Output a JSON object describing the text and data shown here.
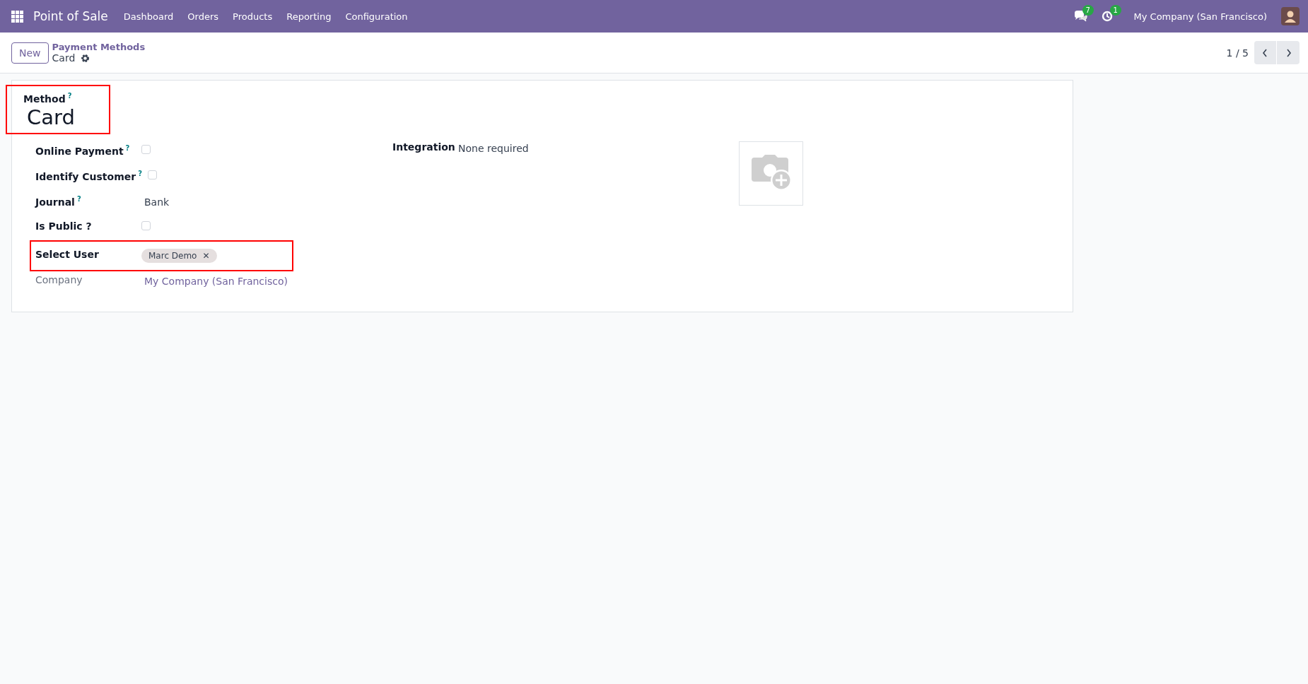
{
  "navbar": {
    "app_name": "Point of Sale",
    "menu": [
      "Dashboard",
      "Orders",
      "Products",
      "Reporting",
      "Configuration"
    ],
    "messages_count": "7",
    "activities_count": "1",
    "company": "My Company (San Francisco)"
  },
  "control_panel": {
    "new_button": "New",
    "breadcrumb": "Payment Methods",
    "record": "Card",
    "pager": "1 / 5"
  },
  "form": {
    "method": {
      "label": "Method",
      "help_mark": "?",
      "value": "Card",
      "highlighted": true
    },
    "fields": [
      {
        "kind": "checkbox",
        "label": "Online Payment",
        "help_mark": "?",
        "checked": false,
        "highlighted": false
      },
      {
        "kind": "checkbox",
        "label": "Identify Customer",
        "help_mark": "?",
        "checked": false,
        "highlighted": false
      },
      {
        "kind": "text",
        "label": "Journal",
        "help_mark": "?",
        "value": "Bank",
        "highlighted": false
      },
      {
        "kind": "checkbox",
        "label": "Is Public ?",
        "checked": false,
        "highlighted": false
      },
      {
        "kind": "tags",
        "label": "Select User",
        "tags": [
          {
            "label": "Marc Demo",
            "remove_mark": "✕"
          }
        ],
        "highlighted": true
      },
      {
        "kind": "link",
        "label": "Company",
        "value": "My Company (San Francisco)",
        "highlighted": false
      }
    ],
    "integration": {
      "label": "Integration",
      "value": "None required"
    }
  }
}
